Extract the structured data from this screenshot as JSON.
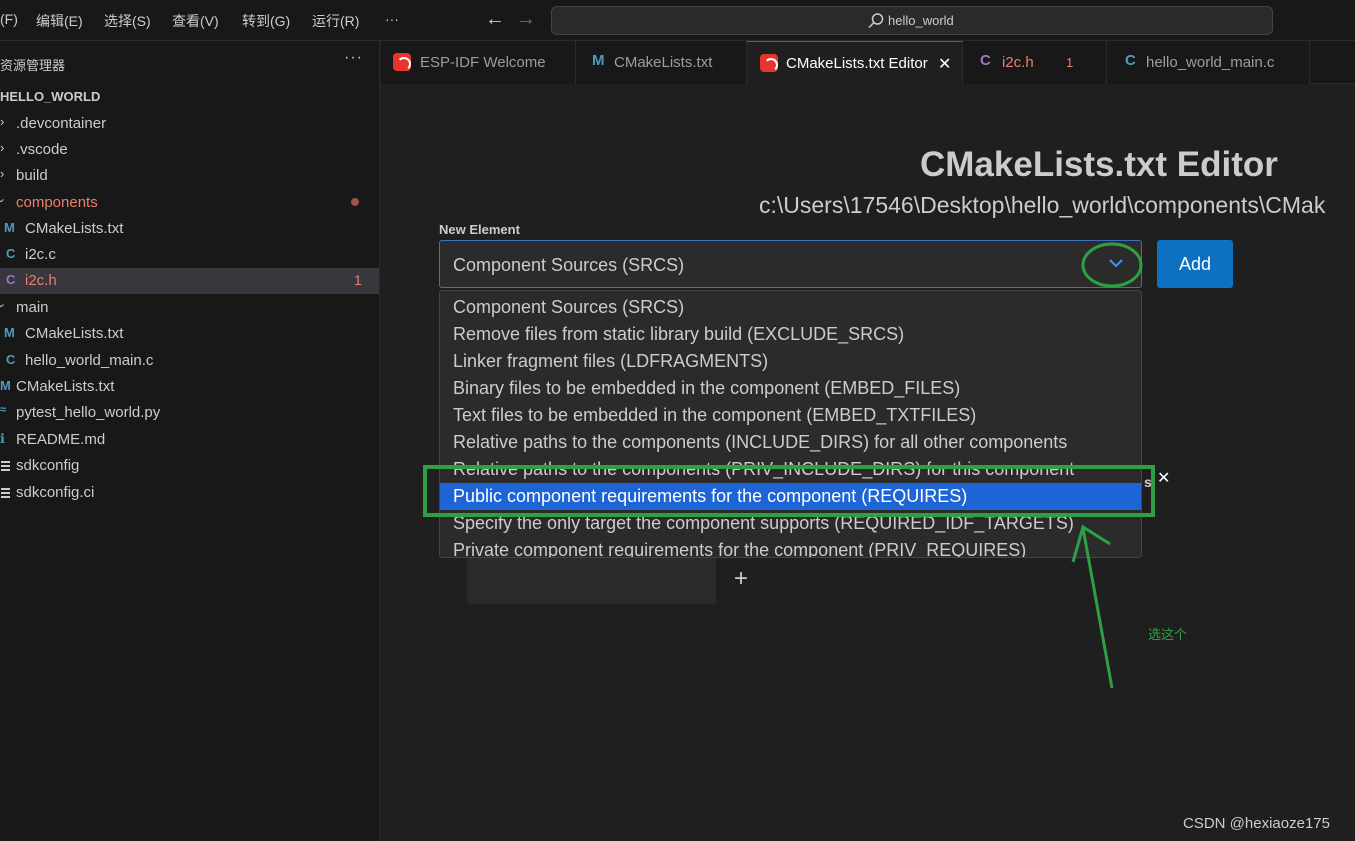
{
  "menu": {
    "items": [
      "(F)",
      "编辑(E)",
      "选择(S)",
      "查看(V)",
      "转到(G)",
      "运行(R)",
      "···"
    ],
    "search_text": "hello_world"
  },
  "sidebar": {
    "title": "资源管理器",
    "more": "···",
    "project": "HELLO_WORLD",
    "items": [
      {
        "label": ".devcontainer",
        "type": "folder-collapsed"
      },
      {
        "label": ".vscode",
        "type": "folder-collapsed"
      },
      {
        "label": "build",
        "type": "folder-collapsed"
      },
      {
        "label": "components",
        "type": "folder-expanded",
        "status": "modified"
      },
      {
        "label": "CMakeLists.txt",
        "icon": "M"
      },
      {
        "label": "i2c.c",
        "icon": "C"
      },
      {
        "label": "i2c.h",
        "icon": "C",
        "badge": "1",
        "selected": true
      },
      {
        "label": "main",
        "type": "folder-expanded"
      },
      {
        "label": "CMakeLists.txt",
        "icon": "M"
      },
      {
        "label": "hello_world_main.c",
        "icon": "C"
      },
      {
        "label": "CMakeLists.txt",
        "icon": "M"
      },
      {
        "label": "pytest_hello_world.py",
        "icon": "py"
      },
      {
        "label": "README.md",
        "icon": "info"
      },
      {
        "label": "sdkconfig",
        "icon": "lines"
      },
      {
        "label": "sdkconfig.ci",
        "icon": "lines"
      }
    ]
  },
  "tabs": [
    {
      "label": "ESP-IDF Welcome",
      "icon": "esp"
    },
    {
      "label": "CMakeLists.txt",
      "icon": "M"
    },
    {
      "label": "CMakeLists.txt Editor",
      "icon": "esp",
      "active": true,
      "close": "✕"
    },
    {
      "label": "i2c.h",
      "icon": "C",
      "badge": "1"
    },
    {
      "label": "hello_world_main.c",
      "icon": "C"
    }
  ],
  "editor": {
    "title": "CMakeLists.txt Editor",
    "path": "c:\\Users\\17546\\Desktop\\hello_world\\components\\CMak",
    "new_element_label": "New Element",
    "select_value": "Component Sources (SRCS)",
    "add_label": "Add",
    "options": [
      "Component Sources (SRCS)",
      "Remove files from static library build (EXCLUDE_SRCS)",
      "Linker fragment files (LDFRAGMENTS)",
      "Binary files to be embedded in the component (EMBED_FILES)",
      "Text files to be embedded in the component (EMBED_TXTFILES)",
      "Relative paths to the components (INCLUDE_DIRS) for all other components",
      "Relative paths to the components (PRIV_INCLUDE_DIRS) for this component",
      "Public component requirements for the component (REQUIRES)",
      "Specify the only target the component supports (REQUIRED_IDF_TARGETS)",
      "Private component requirements for the component (PRIV_REQUIRES)"
    ],
    "selected_option_index": 7,
    "plus": "+",
    "close_x": "✕",
    "s_fragment": "s"
  },
  "annotation": {
    "text": "选这个",
    "color": "#2ea043"
  },
  "watermark": "CSDN @hexiaoze175",
  "colors": {
    "accent": "#0e70c0",
    "selected_option": "#1d64d4",
    "error": "#e8806a",
    "annotation": "#2ea043"
  }
}
